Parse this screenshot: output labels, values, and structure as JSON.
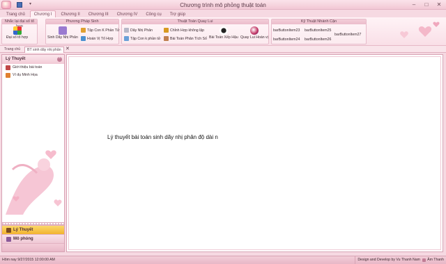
{
  "window": {
    "title": "Chương trình mô phỏng thuật toán",
    "controls": [
      "–",
      "□",
      "✕"
    ]
  },
  "ribbon_tabs": [
    "Trang chủ",
    "Chương I",
    "Chương II",
    "Chương III",
    "Chương IV",
    "Công cụ",
    "Trợ giúp"
  ],
  "groups": {
    "g1": {
      "title": "Nhắc lại đại số tổ hợp",
      "big_label": "Đại số tổ hợp"
    },
    "g2": {
      "title": "Phương Pháp Sinh",
      "big_label": "Sinh Dãy Nhị Phân",
      "items": [
        "Tập Con K Phần Tử",
        "Hoán Vị Tổ Hợp"
      ]
    },
    "g3": {
      "title": "Thuật Toán Quay Lui",
      "items": [
        "Dãy Nhị Phân",
        "Chỉnh Hợp không lặp",
        "Tập Con k phần tử",
        "Bài Toán Phân Tích Số"
      ],
      "big": [
        "Bài Toán Xếp Hậu",
        "Quay Lui Hoán vị"
      ]
    },
    "g4": {
      "title": "Kỹ Thuật Nhánh Cận",
      "items": [
        "barButtonItem23",
        "barButtonItem25",
        "barButtonItem24",
        "barButtonItem26",
        "barButtonItem27"
      ]
    }
  },
  "doc_tabs": [
    "Trang chủ",
    "BT sinh dãy nhị phân"
  ],
  "doc_close": "✕",
  "sidebar": {
    "title": "Lý Thuyết",
    "collapse": "⌃",
    "items": [
      "Giới thiệu bài toán",
      "Ví dụ Minh Họa"
    ],
    "nav": [
      "Lý Thuyết",
      "Mô phỏng"
    ]
  },
  "main": {
    "text": "Lý thuyết bài toán sinh dãy nhị phân độ dài n"
  },
  "status": {
    "left": "Hôm nay 9/27/2015 12:00:00 AM",
    "right": "Design and Develop by Vu Thanh Nam",
    "skin": "Âm Thanh"
  },
  "colors": {
    "accent": "#f2b330",
    "pink": "#f2c8d5",
    "border": "#d7a3b4"
  },
  "icons": [
    "app-orb-icon",
    "save-icon",
    "heart-icon",
    "bell-icon",
    "gear-icon",
    "queen-icon",
    "ball-icon"
  ]
}
